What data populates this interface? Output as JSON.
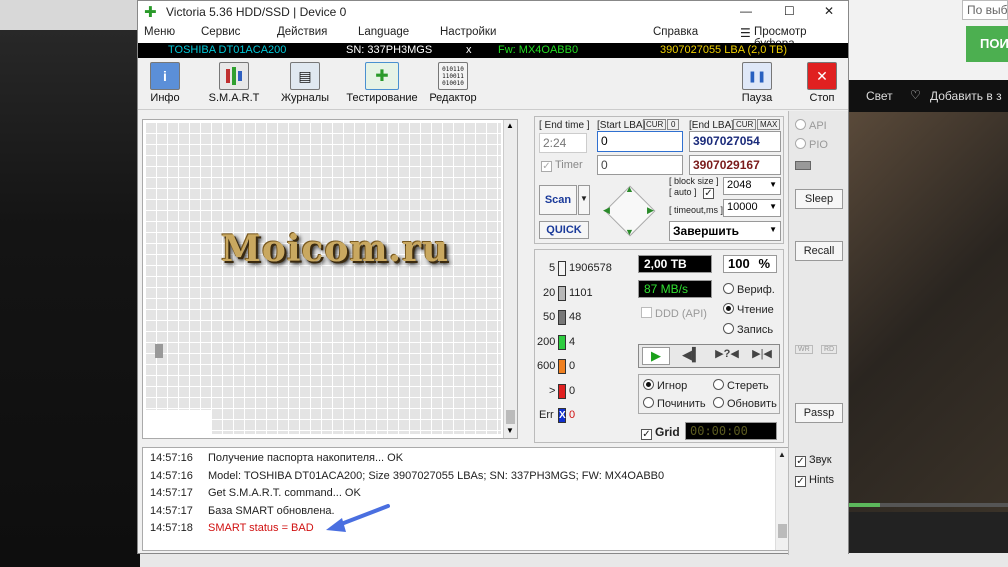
{
  "window": {
    "title": "Victoria 5.36 HDD/SSD | Device 0",
    "controls": {
      "minimize": "—",
      "maximize": "☐",
      "close": "✕"
    }
  },
  "menu": {
    "items": [
      "Меню",
      "Сервис",
      "Действия",
      "Language",
      "Настройки",
      "Справка"
    ],
    "clipboard_view": "Просмотр буфера"
  },
  "device": {
    "model": "TOSHIBA DT01ACA200",
    "serial": "SN: 337PH3MGS",
    "close_mark": "x",
    "firmware": "Fw: MX4OABB0",
    "capacity": "3907027055 LBA (2,0 TB)"
  },
  "toolbar": {
    "info": "Инфо",
    "smart": "S.M.A.R.T",
    "logs": "Журналы",
    "testing": "Тестирование",
    "editor": "Редактор",
    "pause": "Пауза",
    "stop": "Стоп",
    "editor_icon_text": "010110\n110011\n010010"
  },
  "scan_controls": {
    "end_time_label": "[ End time ]",
    "end_time_value": "2:24",
    "start_lba_label": "[Start LBA]",
    "cur_label": "CUR",
    "zero_label": "0",
    "start_lba_value": "0",
    "end_lba_label": "[End LBA]",
    "max_label": "MAX",
    "end_lba_value": "3907027054",
    "timer_label": "Timer",
    "timer_value": "0",
    "end_lba_max_value": "3907029167",
    "scan_button": "Scan",
    "quick_button": "QUICK",
    "block_size_label": "[ block size ]",
    "auto_label": "[ auto ]",
    "block_size_value": "2048",
    "timeout_label": "[ timeout,ms ]",
    "timeout_value": "10000",
    "finish_label": "Завершить"
  },
  "stats": {
    "rows": [
      {
        "label": "5",
        "count": "1906578",
        "color": "#f4f4f4"
      },
      {
        "label": "20",
        "count": "1101",
        "color": "#b8b8b8"
      },
      {
        "label": "50",
        "count": "48",
        "color": "#777777"
      },
      {
        "label": "200",
        "count": "4",
        "color": "#2ecc40"
      },
      {
        "label": "600",
        "count": "0",
        "color": "#f08020"
      },
      {
        "label": ">",
        "count": "0",
        "color": "#e02020"
      },
      {
        "label": "Err",
        "count": "0",
        "color": "#1030d0",
        "glyph": "X"
      }
    ],
    "total_size": "2,00 TB",
    "percent": "100",
    "percent_sign": "%",
    "speed": "87 MB/s",
    "ddd_label": "DDD (API)",
    "verify_label": "Вериф.",
    "read_label": "Чтение",
    "write_label": "Запись",
    "ignore_label": "Игнор",
    "erase_label": "Стереть",
    "repair_label": "Починить",
    "refresh_label": "Обновить",
    "grid_label": "Grid",
    "grid_timer": "00:00:00"
  },
  "side": {
    "api_label": "API",
    "pio_label": "PIO",
    "sleep": "Sleep",
    "recall": "Recall",
    "wr_label": "WR",
    "rd_label": "RD",
    "passp": "Passp",
    "sound_label": "Звук",
    "hints_label": "Hints"
  },
  "log": [
    {
      "time": "14:57:16",
      "text": "Получение паспорта накопителя... OK",
      "color": "#222222"
    },
    {
      "time": "14:57:16",
      "text": "Model: TOSHIBA DT01ACA200; Size 3907027055 LBAs; SN: 337PH3MGS; FW: MX4OABB0",
      "color": "#222222"
    },
    {
      "time": "14:57:17",
      "text": "Get S.M.A.R.T. command... OK",
      "color": "#222222"
    },
    {
      "time": "14:57:17",
      "text": "База SMART обновлена.",
      "color": "#222222"
    },
    {
      "time": "14:57:18",
      "text": "SMART status = BAD",
      "color": "#d01010"
    }
  ],
  "watermark": "Moicom.ru",
  "background": {
    "search_placeholder": "По выб",
    "green_button": "ПОИ",
    "video_light": "Свет",
    "video_add": "Добавить в з"
  },
  "colors": {
    "model_cyan": "#00c8d8",
    "serial_white": "#ffffff",
    "fw_green": "#22dd22",
    "capacity_yellow": "#f0d000",
    "speed_green": "#30e030",
    "arrow_blue": "#4a6fe0"
  }
}
